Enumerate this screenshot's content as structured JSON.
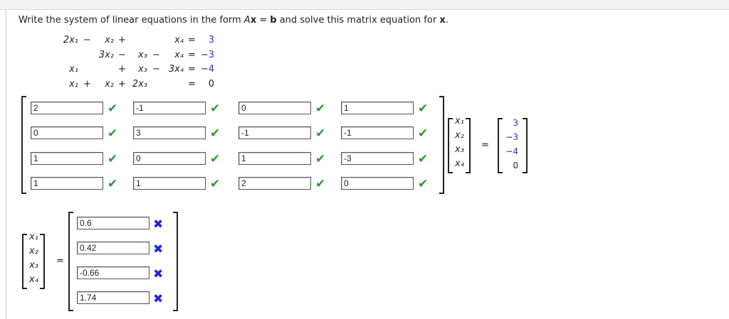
{
  "title": {
    "pre": "Write the system of linear equations in the form ",
    "A": "A",
    "x": "x",
    "eq": " = ",
    "b": "b",
    "post": " and solve this matrix equation for ",
    "x2": "x",
    "end": "."
  },
  "equations": [
    [
      "2x₁",
      "−",
      "x₂",
      "+",
      "",
      "",
      "x₄",
      "=",
      "3"
    ],
    [
      "",
      "",
      "3x₂",
      "−",
      "x₃",
      "−",
      "x₄",
      "=",
      "−3"
    ],
    [
      "x₁",
      "",
      "",
      "+",
      "x₃",
      "−",
      "3x₄",
      "=",
      "−4"
    ],
    [
      "x₁",
      "+",
      "x₂",
      "+",
      "2x₃",
      "",
      "",
      "=",
      "0"
    ]
  ],
  "matrix_A": [
    [
      "2",
      "-1",
      "0",
      "1"
    ],
    [
      "0",
      "3",
      "-1",
      "-1"
    ],
    [
      "1",
      "0",
      "1",
      "-3"
    ],
    [
      "1",
      "1",
      "2",
      "0"
    ]
  ],
  "matrix_A_status": "correct",
  "x_vector": [
    "x₁",
    "x₂",
    "x₃",
    "x₄"
  ],
  "equals": "=",
  "b_vector": [
    "3",
    "−3",
    "−4",
    "0"
  ],
  "solution": [
    "0.6",
    "0.42",
    "-0.66",
    "1.74"
  ],
  "solution_status": "incorrect",
  "icons": {
    "correct": "✔",
    "incorrect": "✖"
  },
  "colors": {
    "check": "#2a9a2a",
    "cross": "#2323e0",
    "blue_value": "#3333cc"
  }
}
